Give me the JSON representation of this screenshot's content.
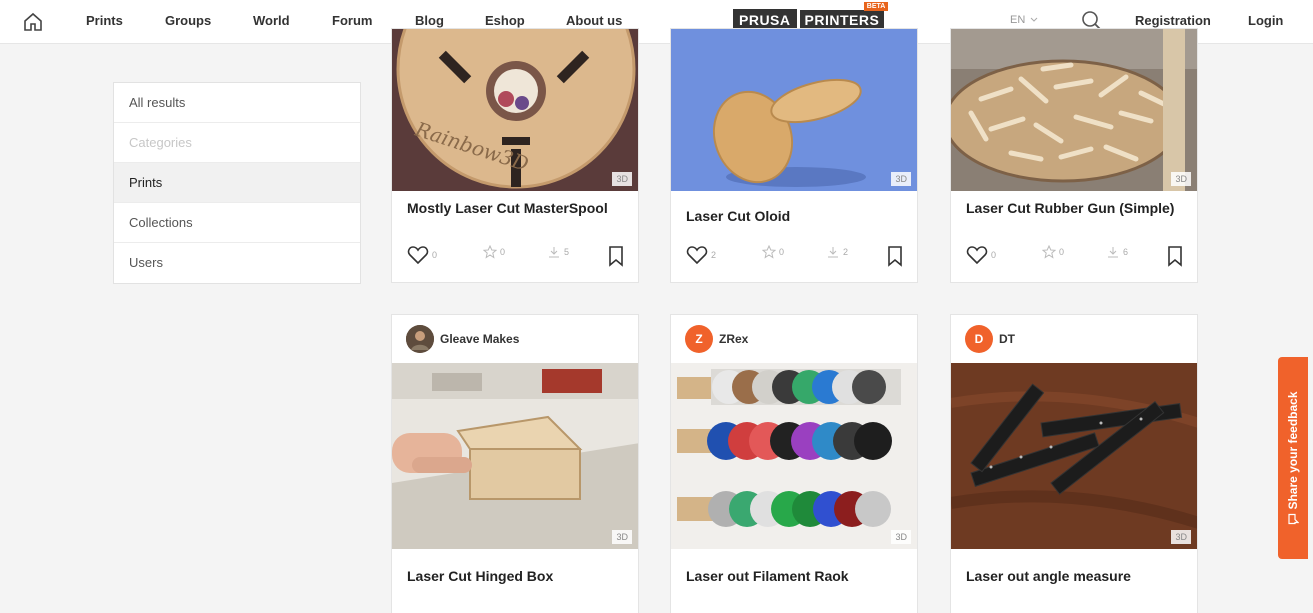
{
  "nav": {
    "links": [
      "Prints",
      "Groups",
      "World",
      "Forum",
      "Blog",
      "Eshop",
      "About us"
    ],
    "logo_word1": "PRUSA",
    "logo_word2": "PRINTERS",
    "logo_badge": "BETA",
    "language": "EN",
    "registration": "Registration",
    "login": "Login"
  },
  "sidebar": {
    "items": [
      {
        "label": "All results",
        "state": "normal"
      },
      {
        "label": "Categories",
        "state": "disabled"
      },
      {
        "label": "Prints",
        "state": "selected"
      },
      {
        "label": "Collections",
        "state": "normal"
      },
      {
        "label": "Users",
        "state": "normal"
      }
    ]
  },
  "cards": [
    {
      "title": "Mostly Laser Cut MasterSpool",
      "badge": "3D",
      "likes": "0",
      "ratings": "0",
      "downloads": "5",
      "author": ""
    },
    {
      "title": "Laser Cut Oloid",
      "badge": "3D",
      "likes": "2",
      "ratings": "0",
      "downloads": "2",
      "author": ""
    },
    {
      "title": "Laser Cut Rubber Gun (Simple)",
      "badge": "3D",
      "likes": "0",
      "ratings": "0",
      "downloads": "6",
      "author": ""
    },
    {
      "title": "Laser Cut Hinged Box",
      "badge": "3D",
      "author": "Gleave Makes",
      "avatar_letter": ""
    },
    {
      "title": "Laser out Filament Raok",
      "badge": "3D",
      "author": "ZRex",
      "avatar_letter": "Z"
    },
    {
      "title": "Laser out angle measure",
      "badge": "3D",
      "author": "DT",
      "avatar_letter": "D"
    }
  ],
  "feedback": {
    "label": "Share your feedback"
  },
  "colors": {
    "accent": "#f0622b",
    "nav_bg": "#ffffff",
    "page_bg": "#f4f4f4"
  }
}
